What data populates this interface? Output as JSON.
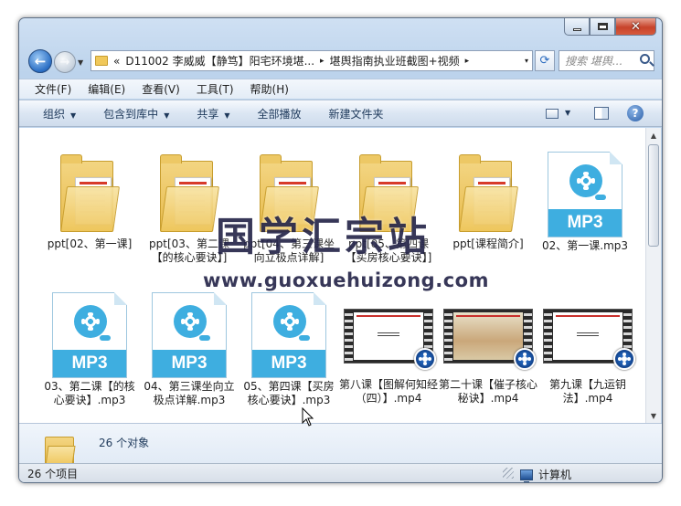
{
  "address": {
    "chevrons": "«",
    "segments": [
      "D11002 李威威【静笃】阳宅环境堪...",
      "堪舆指南执业班截图+视频"
    ],
    "separator": "▸",
    "dropdown": "▾"
  },
  "search": {
    "placeholder": "搜索 堪舆..."
  },
  "menu": [
    "文件(F)",
    "编辑(E)",
    "查看(V)",
    "工具(T)",
    "帮助(H)"
  ],
  "commands": {
    "organize": "组织",
    "include_library": "包含到库中",
    "share": "共享",
    "play_all": "全部播放",
    "new_folder": "新建文件夹"
  },
  "files": [
    {
      "type": "folder",
      "name": "ppt[02、第一课]"
    },
    {
      "type": "folder",
      "name": "ppt[03、第二课【的核心要诀】]"
    },
    {
      "type": "folder",
      "name": "ppt[04、第三课坐向立极点详解]"
    },
    {
      "type": "folder",
      "name": "ppt[05、第四课【买房核心要诀】]"
    },
    {
      "type": "folder",
      "name": "ppt[课程简介]"
    },
    {
      "type": "mp3",
      "name": "02、第一课.mp3",
      "badge": "MP3"
    },
    {
      "type": "mp3",
      "name": "03、第二课【的核心要诀】.mp3",
      "badge": "MP3"
    },
    {
      "type": "mp3",
      "name": "04、第三课坐向立极点详解.mp3",
      "badge": "MP3"
    },
    {
      "type": "mp3",
      "name": "05、第四课【买房核心要诀】.mp3",
      "badge": "MP3"
    },
    {
      "type": "video",
      "name": "第八课【图解何知经（四）】.mp4"
    },
    {
      "type": "video",
      "name": "第二十课【催子核心秘诀】.mp4"
    },
    {
      "type": "video",
      "name": "第九课【九运钥法】.mp4"
    }
  ],
  "details": {
    "count": "26 个对象"
  },
  "status": {
    "items": "26 个项目",
    "location": "计算机"
  },
  "watermark": {
    "line1": "国学汇宗站",
    "line2": "www.guoxuehuizong.com"
  }
}
